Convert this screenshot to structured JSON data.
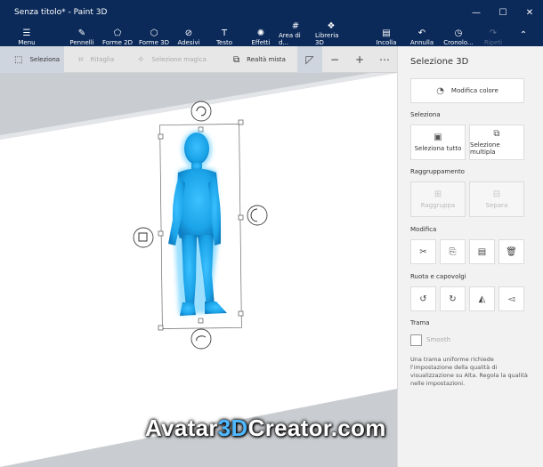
{
  "window": {
    "title": "Senza titolo* - Paint 3D",
    "controls": {
      "minimize": "—",
      "maximize": "☐",
      "close": "✕"
    }
  },
  "ribbon": {
    "menu": {
      "label": "Menu",
      "icon": "hamburger-icon"
    },
    "tools": [
      {
        "label": "Pennelli",
        "icon": "brush-icon"
      },
      {
        "label": "Forme 2D",
        "icon": "shapes-2d-icon"
      },
      {
        "label": "Forme 3D",
        "icon": "cube-icon"
      },
      {
        "label": "Adesivi",
        "icon": "sticker-icon"
      },
      {
        "label": "Testo",
        "icon": "text-icon"
      },
      {
        "label": "Effetti",
        "icon": "sun-icon"
      },
      {
        "label": "Area di d...",
        "icon": "canvas-icon"
      },
      {
        "label": "Libreria 3D",
        "icon": "library-icon"
      }
    ],
    "paste": {
      "label": "Incolla",
      "icon": "clipboard-icon"
    },
    "undo": {
      "label": "Annulla",
      "icon": "undo-icon"
    },
    "history": {
      "label": "Cronolo...",
      "icon": "history-icon"
    },
    "redo": {
      "label": "Ripeti",
      "icon": "redo-icon"
    },
    "collapse_icon": "chevron-up-icon"
  },
  "toolbar": {
    "select": "Seleziona",
    "crop": "Ritaglia",
    "magic_select": "Selezione magica",
    "mixed_reality": "Realtà mista"
  },
  "panel": {
    "title": "Selezione 3D",
    "edit_color": "Modifica colore",
    "select_section": "Seleziona",
    "select_all": "Seleziona tutto",
    "multi_select": "Selezione multipla",
    "group_section": "Raggruppamento",
    "group": "Raggruppa",
    "ungroup": "Separa",
    "edit_section": "Modifica",
    "rotate_section": "Ruota e capovolgi",
    "texture_section": "Trama",
    "smooth": "Smooth",
    "note": "Una trama uniforme richiede l'impostazione della qualità di visualizzazione su Alta. Regola la qualità nelle impostazioni."
  },
  "watermark": {
    "prefix": "Avatar",
    "accent": "3D",
    "suffix": "Creator.com"
  },
  "colors": {
    "titlebar": "#0b2a5a",
    "accent": "#1e7fff",
    "model": "#1aa3e8",
    "panel": "#f2f2f2"
  }
}
